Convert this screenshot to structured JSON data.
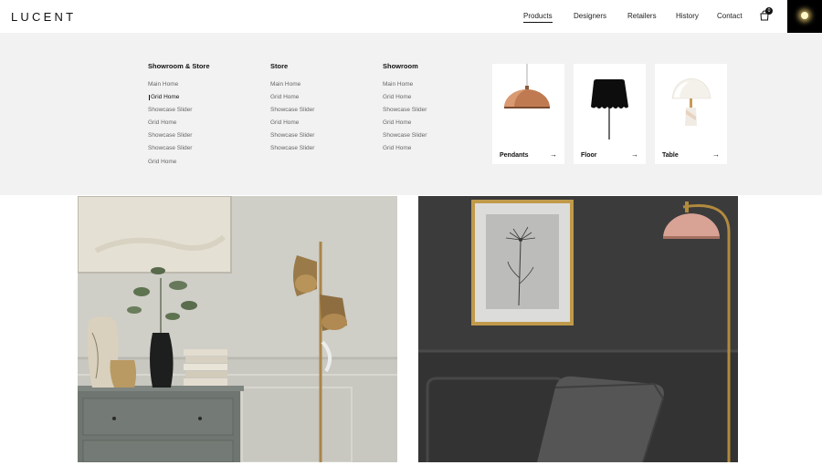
{
  "brand": {
    "logo": "LUCENT"
  },
  "nav": {
    "items": [
      {
        "label": "Products",
        "active": true
      },
      {
        "label": "Designers",
        "active": false
      },
      {
        "label": "Retailers",
        "active": false
      },
      {
        "label": "History",
        "active": false
      },
      {
        "label": "Contact",
        "active": false
      }
    ],
    "cart_count": "0",
    "cart_icon": "shopping-bag-icon",
    "dark_toggle_icon": "glowing-light-icon"
  },
  "mega_menu": {
    "columns": [
      {
        "title": "Showroom & Store",
        "links": [
          "Main Home",
          "Grid Home",
          "Showcase Slider",
          "Grid Home",
          "Showcase Slider",
          "Showcase Slider",
          "Grid Home"
        ],
        "current_index": 1
      },
      {
        "title": "Store",
        "links": [
          "Main Home",
          "Grid Home",
          "Showcase Slider",
          "Grid Home",
          "Showcase Slider",
          "Showcase Slider"
        ]
      },
      {
        "title": "Showroom",
        "links": [
          "Main Home",
          "Grid Home",
          "Showcase Slider",
          "Grid Home",
          "Showcase Slider",
          "Grid Home"
        ]
      }
    ],
    "categories": [
      {
        "label": "Pendants",
        "icon": "pendant-lamp-icon"
      },
      {
        "label": "Floor",
        "icon": "floor-lamp-icon"
      },
      {
        "label": "Table",
        "icon": "table-lamp-icon"
      }
    ],
    "arrow": "→"
  },
  "colors": {
    "accent": "#111111",
    "menu_bg": "#f2f2f2",
    "copper": "#b8704c",
    "brass": "#b28a3e"
  }
}
